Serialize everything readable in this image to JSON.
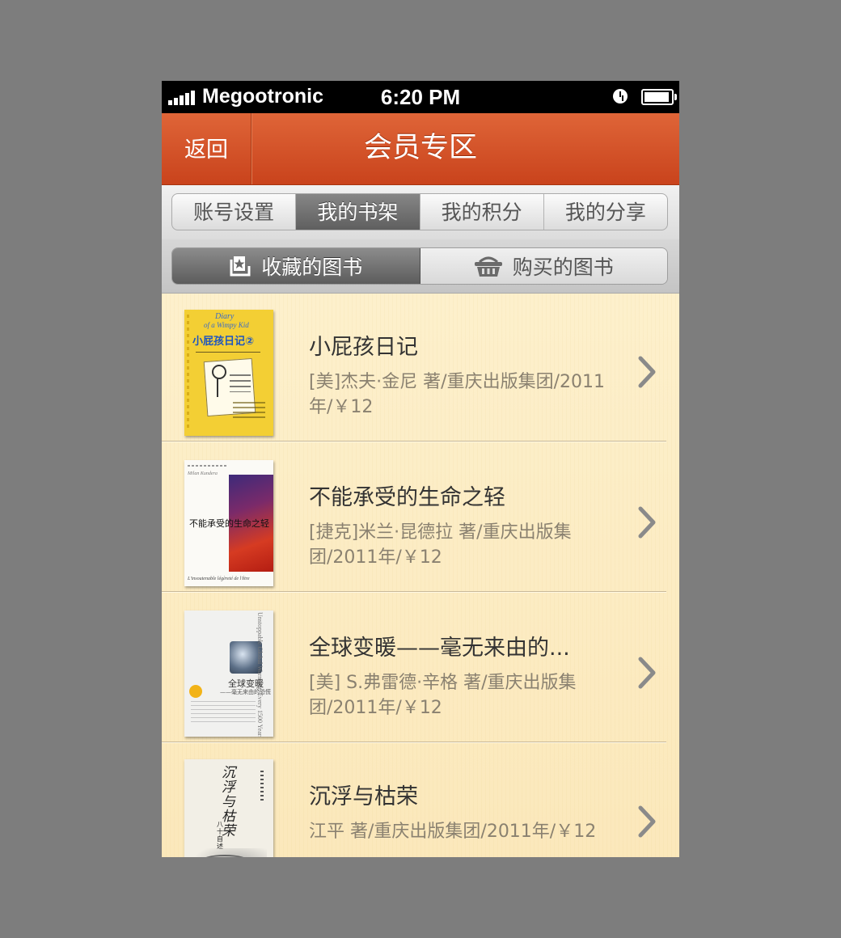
{
  "status_bar": {
    "carrier": "Megootronic",
    "time": "6:20 PM",
    "icons": [
      "signal-icon",
      "clock-icon",
      "battery-icon"
    ]
  },
  "nav": {
    "back_label": "返回",
    "title": "会员专区"
  },
  "tabs": [
    {
      "label": "账号设置",
      "active": false
    },
    {
      "label": "我的书架",
      "active": true
    },
    {
      "label": "我的积分",
      "active": false
    },
    {
      "label": "我的分享",
      "active": false
    }
  ],
  "subtabs": [
    {
      "label": "收藏的图书",
      "icon": "star-box-icon",
      "active": true
    },
    {
      "label": "购买的图书",
      "icon": "basket-icon",
      "active": false
    }
  ],
  "books": [
    {
      "title": "小屁孩日记",
      "meta": "[美]杰夫·金尼 著/重庆出版集团/2011年/￥12",
      "cover_text": [
        "Diary",
        "of a Wimpy Kid",
        "小屁孩日记②"
      ]
    },
    {
      "title": "不能承受的生命之轻",
      "meta": "[捷克]米兰·昆德拉 著/重庆出版集团/2011年/￥12",
      "cover_text": [
        "Milan Kundera",
        "不能承受的生命之轻",
        "L'insoutenable légèreté de l'être"
      ]
    },
    {
      "title": "全球变暖——毫无来由的...",
      "meta": "[美] S.弗雷德·辛格 著/重庆出版集团/2011年/￥12",
      "cover_text": [
        "全球变暖",
        "——毫无来由的恐慌",
        "Unstoppable Global Warming: Every 1500 Years"
      ]
    },
    {
      "title": "沉浮与枯荣",
      "meta": "江平 著/重庆出版集团/2011年/￥12",
      "cover_text": [
        "沉浮与枯荣",
        "八十自述"
      ]
    }
  ],
  "colors": {
    "nav_bar": "#d2502a",
    "list_background": "#fcecc3",
    "page_background": "#7d7d7d"
  }
}
